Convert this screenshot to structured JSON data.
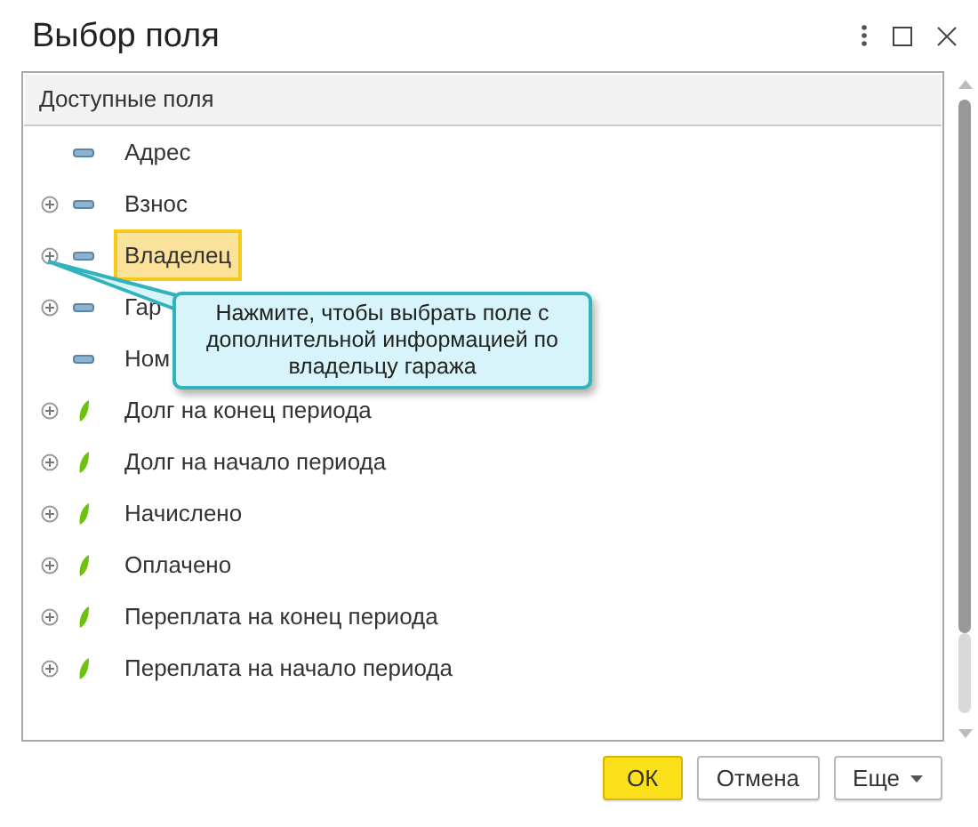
{
  "window": {
    "title": "Выбор поля"
  },
  "table": {
    "header": "Доступные поля",
    "rows": [
      {
        "label": "Адрес",
        "expandable": false,
        "kind": "attribute",
        "selected": false
      },
      {
        "label": "Взнос",
        "expandable": true,
        "kind": "attribute",
        "selected": false
      },
      {
        "label": "Владелец",
        "expandable": true,
        "kind": "attribute",
        "selected": true
      },
      {
        "label": "Гар",
        "expandable": true,
        "kind": "attribute",
        "selected": false
      },
      {
        "label": "Ном",
        "expandable": false,
        "kind": "attribute",
        "selected": false
      },
      {
        "label": "Долг на конец периода",
        "expandable": true,
        "kind": "resource",
        "selected": false
      },
      {
        "label": "Долг на начало периода",
        "expandable": true,
        "kind": "resource",
        "selected": false
      },
      {
        "label": "Начислено",
        "expandable": true,
        "kind": "resource",
        "selected": false
      },
      {
        "label": "Оплачено",
        "expandable": true,
        "kind": "resource",
        "selected": false
      },
      {
        "label": "Переплата на конец периода",
        "expandable": true,
        "kind": "resource",
        "selected": false
      },
      {
        "label": "Переплата на начало периода",
        "expandable": true,
        "kind": "resource",
        "selected": false
      }
    ]
  },
  "callout": {
    "text": "Нажмите, чтобы выбрать поле с дополнительной информацией по владельцу гаража"
  },
  "buttons": [
    {
      "label": "ОК",
      "kind": "primary"
    },
    {
      "label": "Отмена",
      "kind": "default"
    },
    {
      "label": "Еще",
      "kind": "dropdown"
    }
  ]
}
